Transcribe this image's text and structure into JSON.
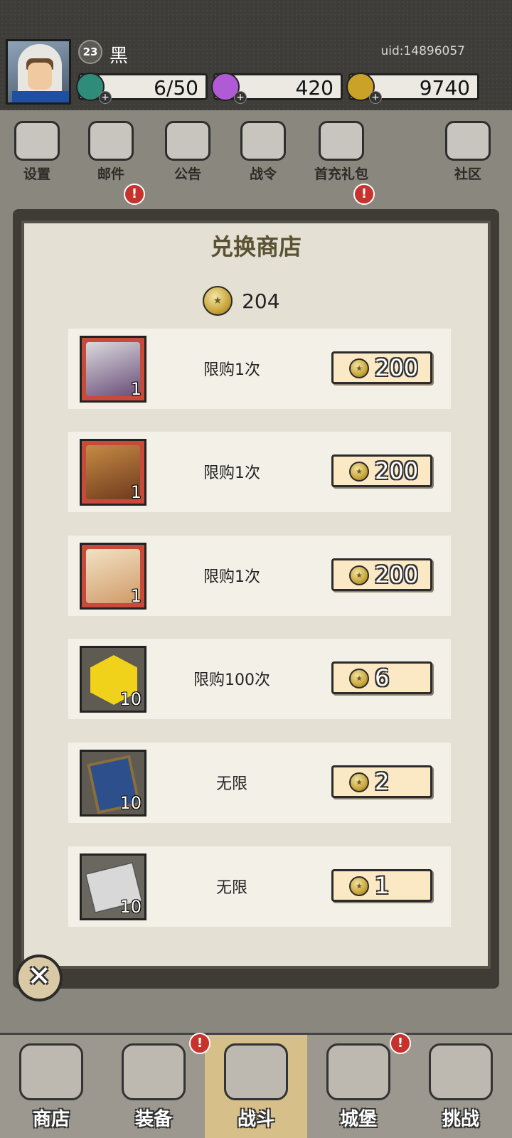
{
  "header": {
    "player_level": "23",
    "player_name": "黑",
    "uid": "uid:14896057",
    "resources": {
      "stamina": "6/50",
      "gems": "420",
      "gold": "9740"
    }
  },
  "menu": [
    {
      "label": "设置",
      "icon": "gear-icon"
    },
    {
      "label": "邮件",
      "icon": "mail-icon"
    },
    {
      "label": "公告",
      "icon": "scroll-icon"
    },
    {
      "label": "战令",
      "icon": "crystal-ball-icon"
    },
    {
      "label": "首充礼包",
      "icon": "gift-bag-icon"
    },
    {
      "label": "社区",
      "icon": "home-icon"
    }
  ],
  "alert_mark": "!",
  "dialog": {
    "title": "兑换商店",
    "balance": "204",
    "close_symbol": "✕",
    "items": [
      {
        "limit": "限购1次",
        "qty": "1",
        "price": "200",
        "icon": "hero-portrait-icon"
      },
      {
        "limit": "限购1次",
        "qty": "1",
        "price": "200",
        "icon": "hero-portrait-icon"
      },
      {
        "limit": "限购1次",
        "qty": "1",
        "price": "200",
        "icon": "hero-portrait-icon"
      },
      {
        "limit": "限购100次",
        "qty": "10",
        "price": "6",
        "icon": "yellow-gem-icon"
      },
      {
        "limit": "无限",
        "qty": "10",
        "price": "2",
        "icon": "book-icon"
      },
      {
        "limit": "无限",
        "qty": "10",
        "price": "1",
        "icon": "stone-icon"
      }
    ]
  },
  "bottom_nav": [
    {
      "label": "商店",
      "icon": "shop-icon"
    },
    {
      "label": "装备",
      "icon": "backpack-icon"
    },
    {
      "label": "战斗",
      "icon": "crossed-swords-icon"
    },
    {
      "label": "城堡",
      "icon": "castle-icon"
    },
    {
      "label": "挑战",
      "icon": "shield-icon"
    }
  ]
}
